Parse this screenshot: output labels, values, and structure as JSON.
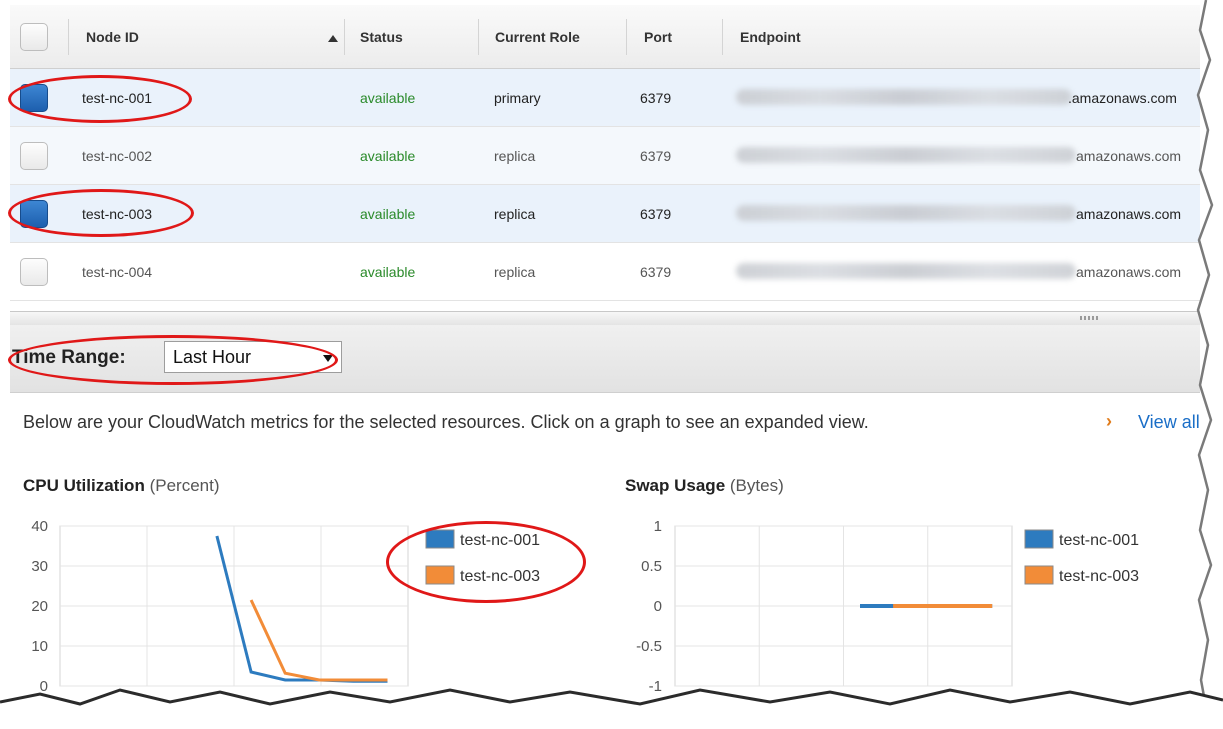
{
  "table": {
    "headers": {
      "node_id": "Node ID",
      "status": "Status",
      "role": "Current Role",
      "port": "Port",
      "endpoint": "Endpoint"
    },
    "rows": [
      {
        "node_id": "test-nc-001",
        "status": "available",
        "role": "primary",
        "port": "6379",
        "endpoint_suffix": ".amazonaws.com",
        "checked": true
      },
      {
        "node_id": "test-nc-002",
        "status": "available",
        "role": "replica",
        "port": "6379",
        "endpoint_suffix": "amazonaws.com",
        "checked": false
      },
      {
        "node_id": "test-nc-003",
        "status": "available",
        "role": "replica",
        "port": "6379",
        "endpoint_suffix": "amazonaws.com",
        "checked": true
      },
      {
        "node_id": "test-nc-004",
        "status": "available",
        "role": "replica",
        "port": "6379",
        "endpoint_suffix": "amazonaws.com",
        "checked": false
      }
    ]
  },
  "time_range": {
    "label": "Time Range:",
    "selected": "Last Hour"
  },
  "description": {
    "text": "Below are your CloudWatch metrics for the selected resources. Click on a graph to see an expanded view.",
    "chevron": "›",
    "link": "View all"
  },
  "colors": {
    "series_blue": "#2d7bbf",
    "series_orange": "#f28c38",
    "status_green": "#2a8a2a",
    "annotation_red": "#e01818"
  },
  "chart_data": [
    {
      "type": "line",
      "title": "CPU Utilization",
      "unit": "(Percent)",
      "ylim": [
        0,
        40
      ],
      "yticks": [
        "40",
        "30",
        "20",
        "10",
        "0"
      ],
      "grid": true,
      "legend": "right",
      "series": [
        {
          "name": "test-nc-001",
          "values": [
            null,
            null,
            null,
            null,
            37.5,
            3.5,
            1.5,
            1.5,
            1.2,
            1.2
          ]
        },
        {
          "name": "test-nc-003",
          "values": [
            null,
            null,
            null,
            null,
            null,
            21.5,
            3.2,
            1.5,
            1.5,
            1.5
          ]
        }
      ]
    },
    {
      "type": "line",
      "title": "Swap Usage",
      "unit": "(Bytes)",
      "ylim": [
        -1,
        1
      ],
      "yticks": [
        "1",
        "0.5",
        "0",
        "-0.5",
        "-1"
      ],
      "grid": true,
      "legend": "right",
      "series": [
        {
          "name": "test-nc-001",
          "values": [
            null,
            null,
            null,
            null,
            null,
            0,
            0,
            0,
            0,
            0
          ]
        },
        {
          "name": "test-nc-003",
          "values": [
            null,
            null,
            null,
            null,
            null,
            null,
            0,
            0,
            0,
            0
          ]
        }
      ]
    }
  ]
}
